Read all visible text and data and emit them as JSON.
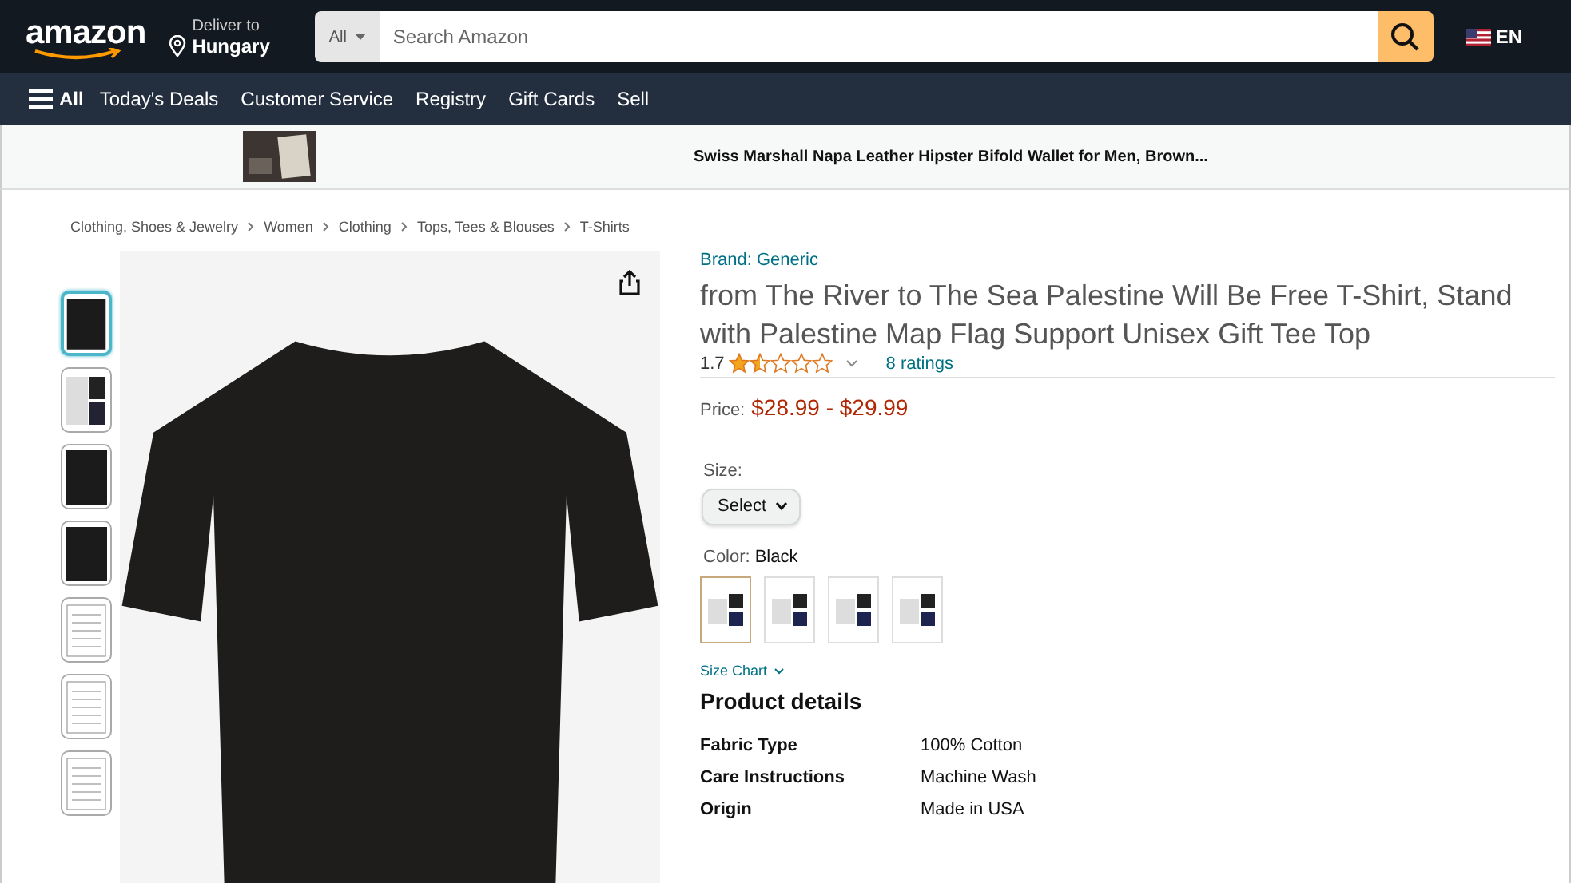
{
  "header": {
    "logo": "amazon",
    "deliver_to": {
      "line1": "Deliver to",
      "line2": "Hungary"
    },
    "search": {
      "category": "All",
      "placeholder": "Search Amazon"
    },
    "language": "EN"
  },
  "nav": {
    "menu_label": "All",
    "links": [
      "Today's Deals",
      "Customer Service",
      "Registry",
      "Gift Cards",
      "Sell"
    ]
  },
  "banner": {
    "text": "Swiss Marshall Napa Leather Hipster Bifold Wallet for Men, Brown..."
  },
  "breadcrumb": [
    "Clothing, Shoes & Jewelry",
    "Women",
    "Clothing",
    "Tops, Tees & Blouses",
    "T-Shirts"
  ],
  "thumbnails": [
    {
      "selected": true,
      "kind": "dark"
    },
    {
      "selected": false,
      "kind": "light"
    },
    {
      "selected": false,
      "kind": "dark"
    },
    {
      "selected": false,
      "kind": "dark"
    },
    {
      "selected": false,
      "kind": "chart"
    },
    {
      "selected": false,
      "kind": "chart"
    },
    {
      "selected": false,
      "kind": "chart"
    }
  ],
  "product": {
    "brand": "Brand: Generic",
    "title": "from The River to The Sea Palestine Will Be Free T-Shirt, Stand with Palestine Map Flag Support Unisex Gift Tee Top",
    "rating": "1.7",
    "stars": 1.5,
    "ratings_count": "8 ratings",
    "price_label": "Price:",
    "price": "$28.99 - $29.99",
    "size_label": "Size:",
    "size_select": "Select",
    "color_label": "Color:",
    "color_value": "Black",
    "color_options": [
      {
        "selected": true
      },
      {
        "selected": false
      },
      {
        "selected": false
      },
      {
        "selected": false
      }
    ],
    "size_chart": "Size Chart",
    "details_heading": "Product details",
    "details": [
      {
        "label": "Fabric Type",
        "value": "100% Cotton"
      },
      {
        "label": "Care Instructions",
        "value": "Machine Wash"
      },
      {
        "label": "Origin",
        "value": "Made in USA"
      }
    ]
  }
}
